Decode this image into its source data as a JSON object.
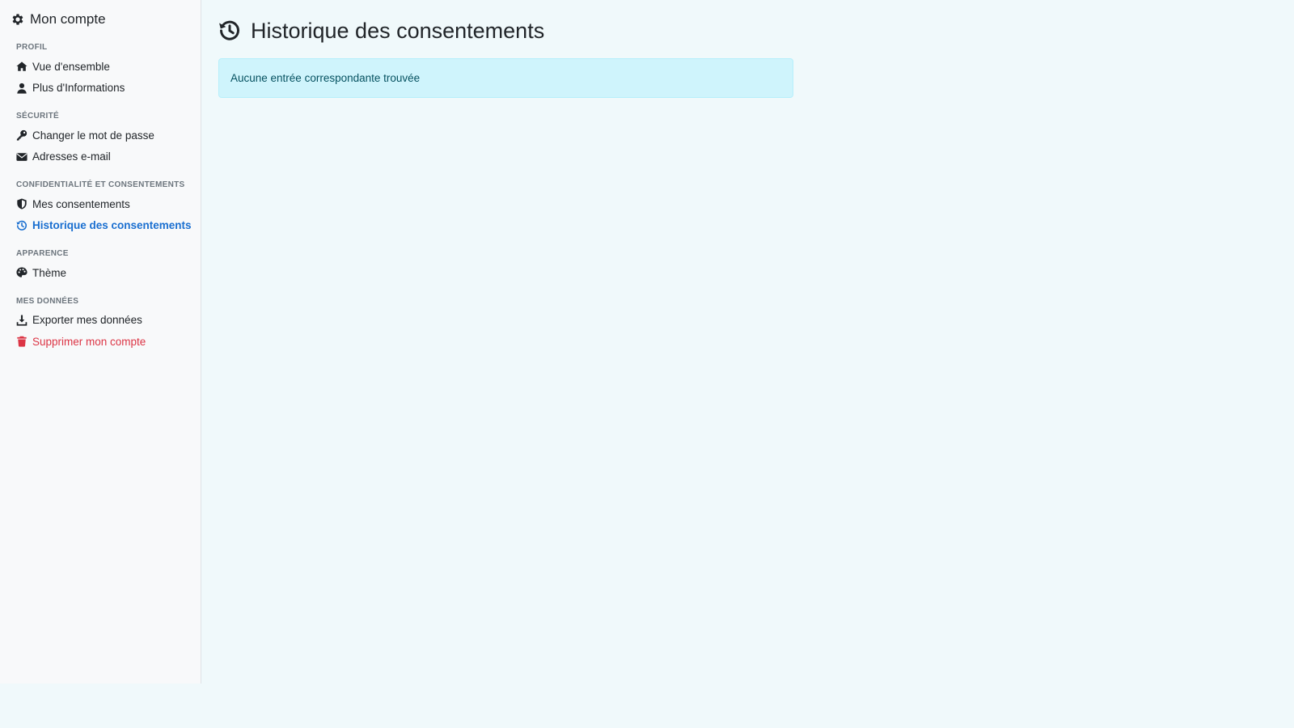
{
  "sidebar": {
    "title": "Mon compte",
    "sections": [
      {
        "label": "PROFIL",
        "items": [
          {
            "label": "Vue d'ensemble",
            "icon": "house-icon"
          },
          {
            "label": "Plus d'Informations",
            "icon": "user-icon"
          }
        ]
      },
      {
        "label": "SÉCURITÉ",
        "items": [
          {
            "label": "Changer le mot de passe",
            "icon": "key-icon"
          },
          {
            "label": "Adresses e-mail",
            "icon": "envelope-icon"
          }
        ]
      },
      {
        "label": "CONFIDENTIALITÉ ET CONSENTEMENTS",
        "items": [
          {
            "label": "Mes consentements",
            "icon": "shield-icon"
          },
          {
            "label": "Historique des consentements",
            "icon": "history-icon",
            "active": true
          }
        ]
      },
      {
        "label": "APPARENCE",
        "items": [
          {
            "label": "Thème",
            "icon": "palette-icon"
          }
        ]
      },
      {
        "label": "MES DONNÉES",
        "items": [
          {
            "label": "Exporter mes données",
            "icon": "download-icon"
          },
          {
            "label": "Supprimer mon compte",
            "icon": "trash-icon",
            "danger": true
          }
        ]
      }
    ]
  },
  "main": {
    "title": "Historique des consentements",
    "alert": "Aucune entrée correspondante trouvée"
  },
  "colors": {
    "accent": "#1a6fd0",
    "danger": "#dc3545",
    "alert_bg": "#cff4fc",
    "page_bg": "#f0f9fb"
  }
}
